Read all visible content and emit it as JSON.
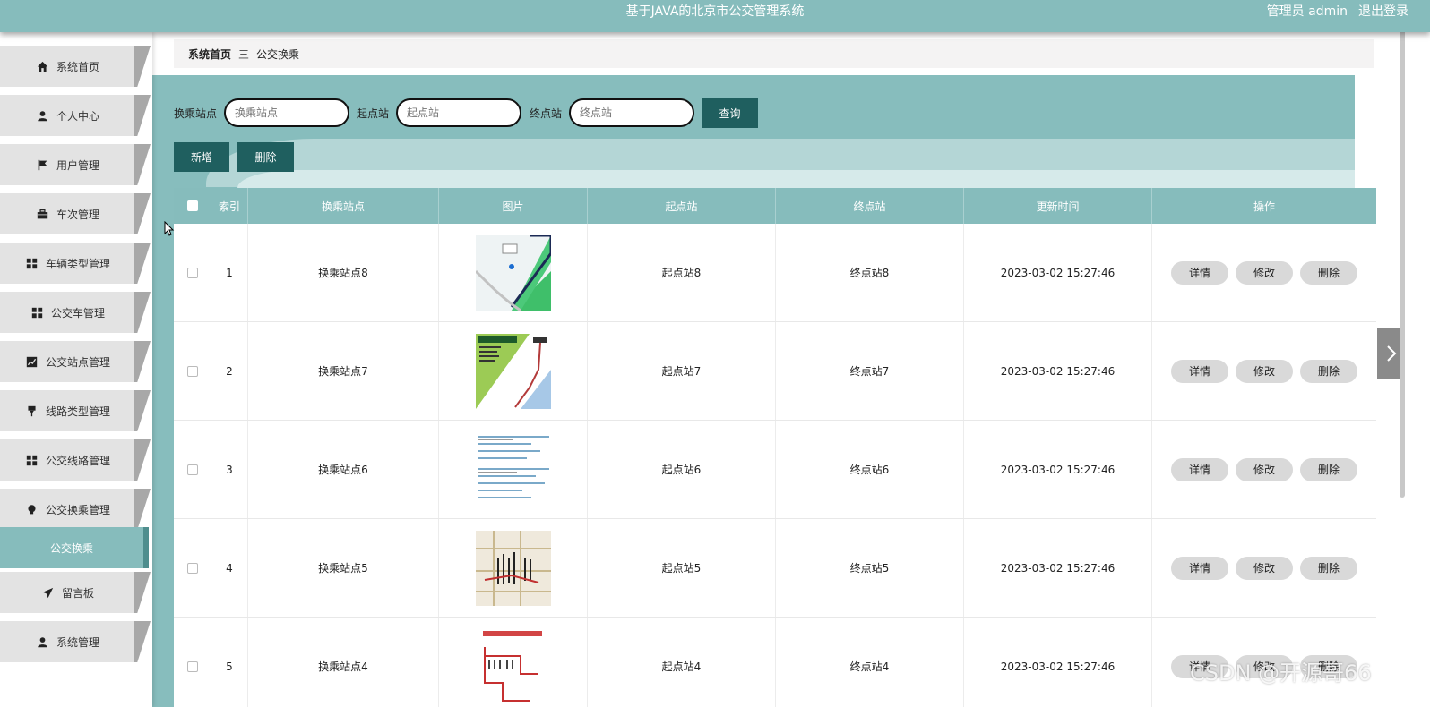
{
  "header": {
    "title": "基于JAVA的北京市公交管理系统",
    "user": "管理员 admin",
    "logout": "退出登录"
  },
  "sidebar": {
    "items": [
      {
        "label": "系统首页",
        "icon": "home-icon"
      },
      {
        "label": "个人中心",
        "icon": "user-icon"
      },
      {
        "label": "用户管理",
        "icon": "flag-icon"
      },
      {
        "label": "车次管理",
        "icon": "briefcase-icon"
      },
      {
        "label": "车辆类型管理",
        "icon": "grid-icon"
      },
      {
        "label": "公交车管理",
        "icon": "grid-icon"
      },
      {
        "label": "公交站点管理",
        "icon": "chart-icon"
      },
      {
        "label": "线路类型管理",
        "icon": "pin-icon"
      },
      {
        "label": "公交线路管理",
        "icon": "grid-icon"
      },
      {
        "label": "公交换乘管理",
        "icon": "bulb-icon"
      },
      {
        "label": "公交换乘",
        "icon": ""
      },
      {
        "label": "留言板",
        "icon": "send-icon"
      },
      {
        "label": "系统管理",
        "icon": "user-icon"
      }
    ]
  },
  "breadcrumb": {
    "home": "系统首页",
    "separator": "三",
    "current": "公交换乘"
  },
  "search": {
    "transfer_label": "换乘站点",
    "transfer_placeholder": "换乘站点",
    "start_label": "起点站",
    "start_placeholder": "起点站",
    "end_label": "终点站",
    "end_placeholder": "终点站",
    "query_button": "查询"
  },
  "actions": {
    "add": "新增",
    "delete": "删除"
  },
  "table": {
    "columns": [
      "索引",
      "换乘站点",
      "图片",
      "起点站",
      "终点站",
      "更新时间",
      "操作"
    ],
    "rows": [
      {
        "index": "1",
        "transfer": "换乘站点8",
        "start": "起点站8",
        "end": "终点站8",
        "time": "2023-03-02 15:27:46",
        "image": "map-thumbnail"
      },
      {
        "index": "2",
        "transfer": "换乘站点7",
        "start": "起点站7",
        "end": "终点站7",
        "time": "2023-03-02 15:27:46",
        "image": "route-map-thumbnail"
      },
      {
        "index": "3",
        "transfer": "换乘站点6",
        "start": "起点站6",
        "end": "终点站6",
        "time": "2023-03-02 15:27:46",
        "image": "timetable-thumbnail"
      },
      {
        "index": "4",
        "transfer": "换乘站点5",
        "start": "起点站5",
        "end": "终点站5",
        "time": "2023-03-02 15:27:46",
        "image": "city-map-thumbnail"
      },
      {
        "index": "5",
        "transfer": "换乘站点4",
        "start": "起点站4",
        "end": "终点站4",
        "time": "2023-03-02 15:27:46",
        "image": "line-diagram-thumbnail"
      }
    ],
    "row_buttons": {
      "detail": "详情",
      "edit": "修改",
      "delete": "删除"
    }
  },
  "watermark": "CSDN @开源哥66",
  "colors": {
    "header": "#86bcbc",
    "dark_button": "#1f5f5f",
    "menu_bg": "#e3e3e3",
    "active_menu": "#86bcbc"
  }
}
